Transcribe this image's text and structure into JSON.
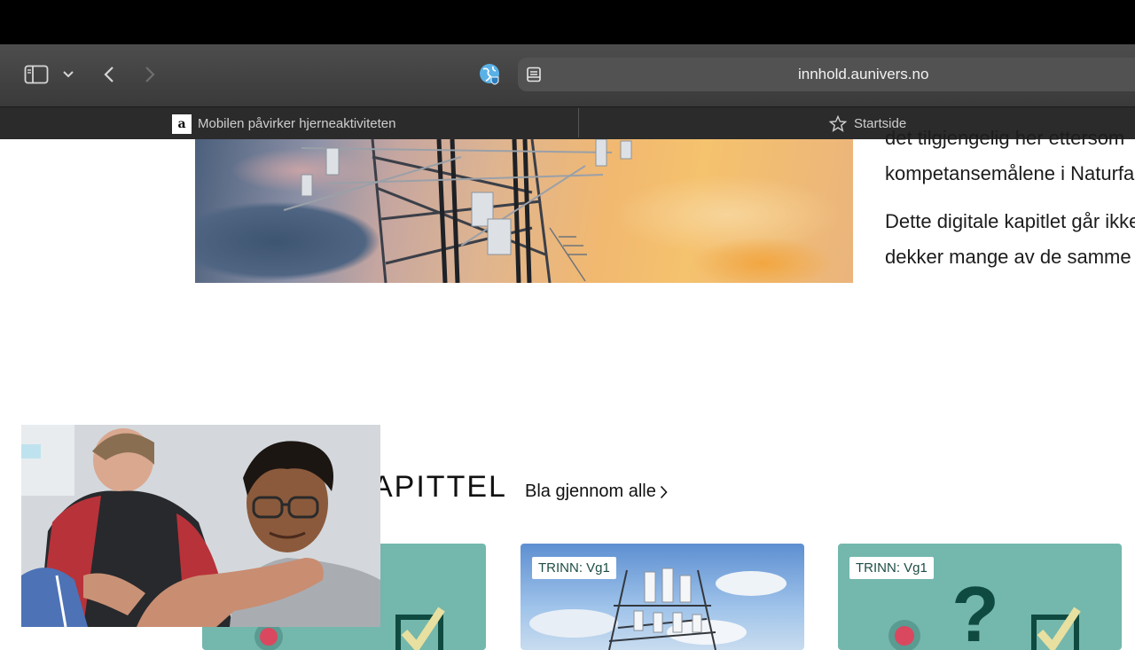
{
  "browser": {
    "url": "innhold.aunivers.no",
    "tabs": [
      {
        "favicon": "a",
        "label": "Mobilen påvirker hjerneaktiviteten"
      },
      {
        "label": "Startside"
      }
    ],
    "icons": [
      "sidebar-icon",
      "chevron-down-icon",
      "back-icon",
      "forward-icon",
      "globe-icon",
      "reader-icon",
      "star-icon"
    ]
  },
  "article": {
    "line1": "det tilgjengelig her ettersom",
    "line2": "kompetansemålene i Naturfag",
    "line3": "Dette digitale kapitlet går ikke",
    "line4": "dekker mange av de samme"
  },
  "section": {
    "title": "APITTEL",
    "browse_label": "Bla gjennom alle"
  },
  "cards": [
    {
      "badge": ""
    },
    {
      "badge": "TRINN: Vg1"
    },
    {
      "badge": "TRINN: Vg1"
    }
  ],
  "colors": {
    "card_teal": "#74b7ad",
    "badge_text": "#1d4d45",
    "dark_green": "#0f4a40",
    "check_yellow": "#e8e0a0",
    "pin_red": "#d9485f"
  }
}
